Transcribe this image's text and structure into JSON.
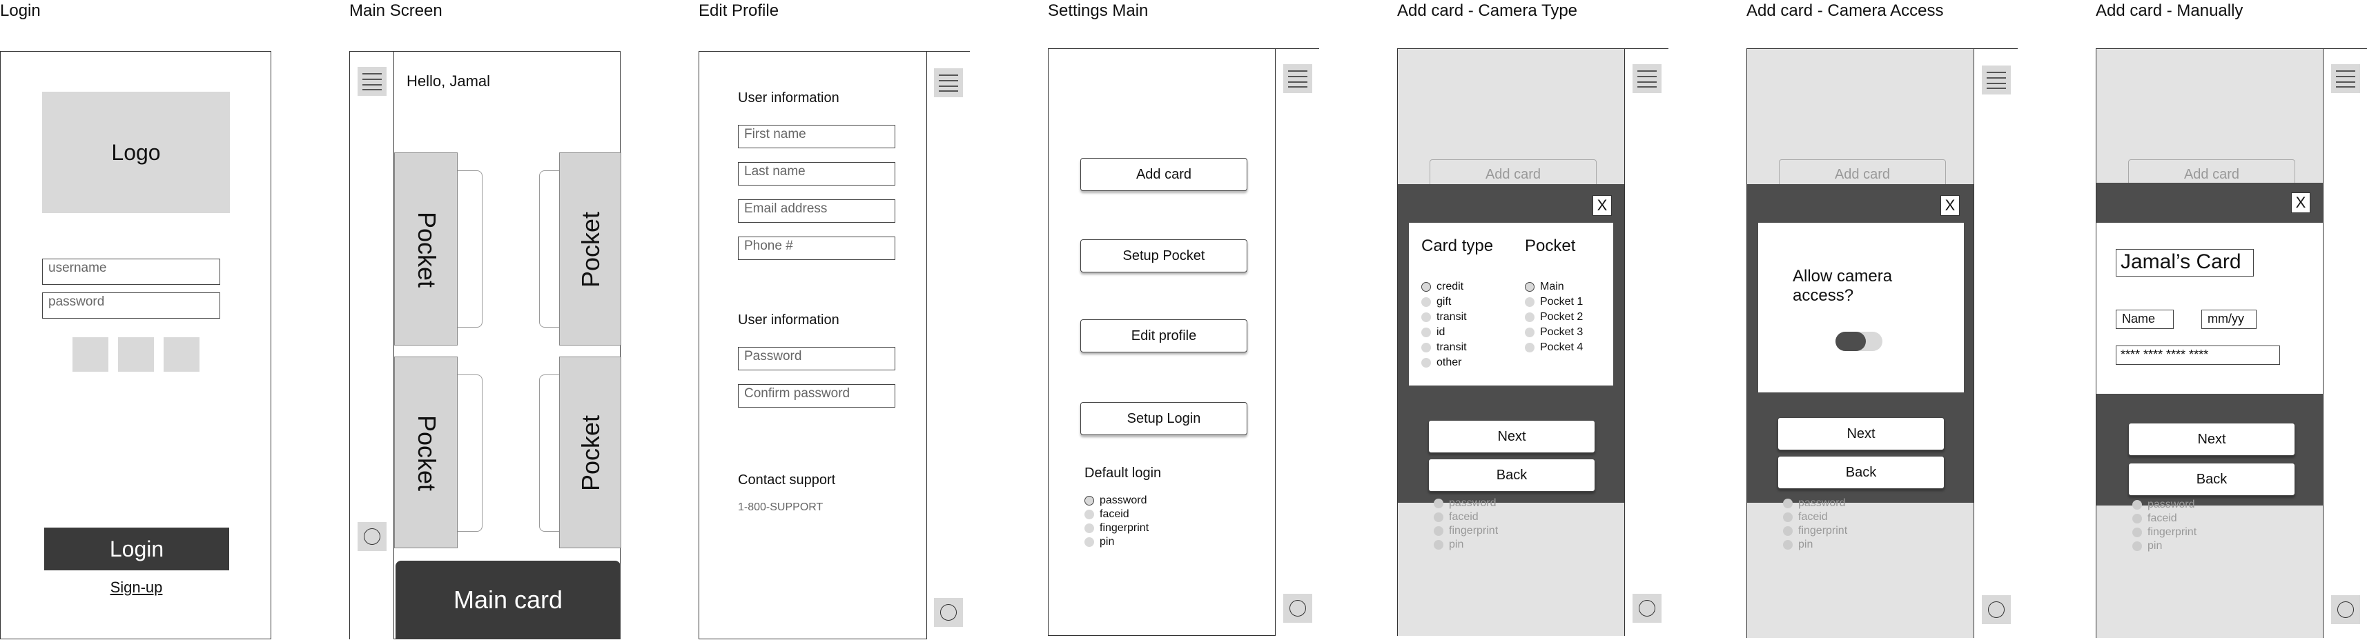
{
  "screens": {
    "login": {
      "title": "Login",
      "logo": "Logo",
      "username_placeholder": "username",
      "password_placeholder": "password",
      "login_button": "Login",
      "signup_link": "Sign-up"
    },
    "main": {
      "title": "Main Screen",
      "greeting": "Hello, Jamal",
      "pocket_label": "Pocket",
      "main_card": "Main card"
    },
    "edit_profile": {
      "title": "Edit Profile",
      "section1": "User information",
      "first_name": "First name",
      "last_name": "Last name",
      "email": "Email address",
      "phone": "Phone #",
      "section2": "User information",
      "password": "Password",
      "confirm_password": "Confirm password",
      "support_heading": "Contact support",
      "support_phone": "1-800-SUPPORT"
    },
    "settings": {
      "title": "Settings Main",
      "add_card": "Add card",
      "setup_pocket": "Setup Pocket",
      "edit_profile": "Edit profile",
      "setup_login": "Setup Login",
      "default_login": "Default login",
      "options": [
        "password",
        "faceid",
        "fingerprint",
        "pin"
      ]
    },
    "camera_type": {
      "title": "Add card - Camera Type",
      "bg_add_card": "Add card",
      "close": "X",
      "card_type_heading": "Card type",
      "card_types": [
        "credit",
        "gift",
        "transit",
        "id",
        "transit",
        "other"
      ],
      "pocket_heading": "Pocket",
      "pockets": [
        "Main",
        "Pocket 1",
        "Pocket 2",
        "Pocket 3",
        "Pocket 4"
      ],
      "next": "Next",
      "back": "Back",
      "bg_options": [
        "password",
        "faceid",
        "fingerprint",
        "pin"
      ]
    },
    "camera_access": {
      "title": "Add card - Camera Access",
      "bg_add_card": "Add card",
      "close": "X",
      "prompt_line1": "Allow camera",
      "prompt_line2": "access?",
      "next": "Next",
      "back": "Back",
      "bg_options": [
        "password",
        "faceid",
        "fingerprint",
        "pin"
      ]
    },
    "manually": {
      "title": "Add card - Manually",
      "bg_add_card": "Add card",
      "close": "X",
      "card_name": "Jamal’s Card",
      "name_field": "Name",
      "expiry_field": "mm/yy",
      "card_number": "**** **** **** ****",
      "next": "Next",
      "back": "Back",
      "bg_options": [
        "password",
        "faceid",
        "fingerprint",
        "pin"
      ]
    }
  },
  "colors": {
    "placeholder_gray": "#d9d9d9",
    "dark_button": "#3a3a3a",
    "modal_dark": "#4d4d4d",
    "overlay_light": "#e3e3e3"
  }
}
